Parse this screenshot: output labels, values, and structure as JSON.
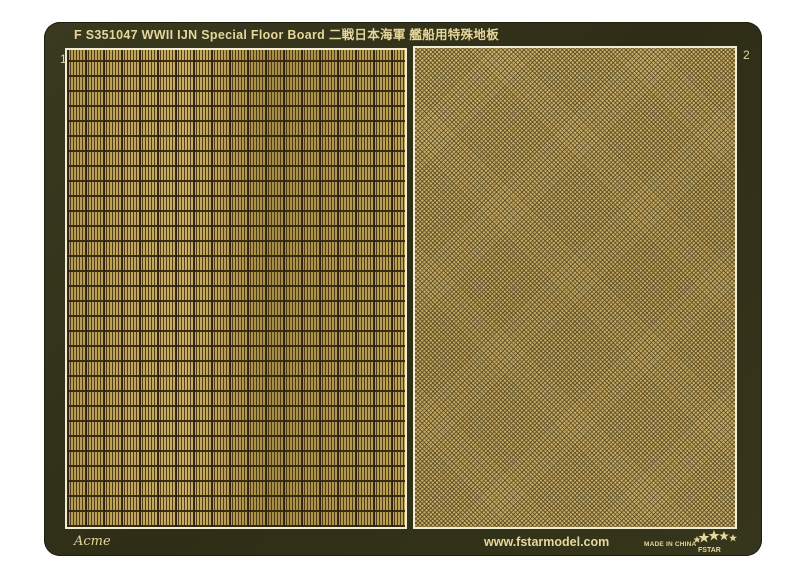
{
  "sheet": {
    "title": "F S351047 WWII IJN Special Floor Board 二戦日本海軍 艦船用特殊地板",
    "panel_numbers": [
      "1",
      "2"
    ],
    "brand_mark": "Acme",
    "website": "www.fstarmodel.com",
    "made_in": "MADE IN CHINA",
    "logo_text": "FSTAR"
  },
  "colors": {
    "sheet_background": "#2e2e18",
    "brass": "#c2a865",
    "text": "#e6d79a",
    "panel_border": "#f2ecd2"
  },
  "icons": {
    "logo": "star-logo-icon"
  }
}
